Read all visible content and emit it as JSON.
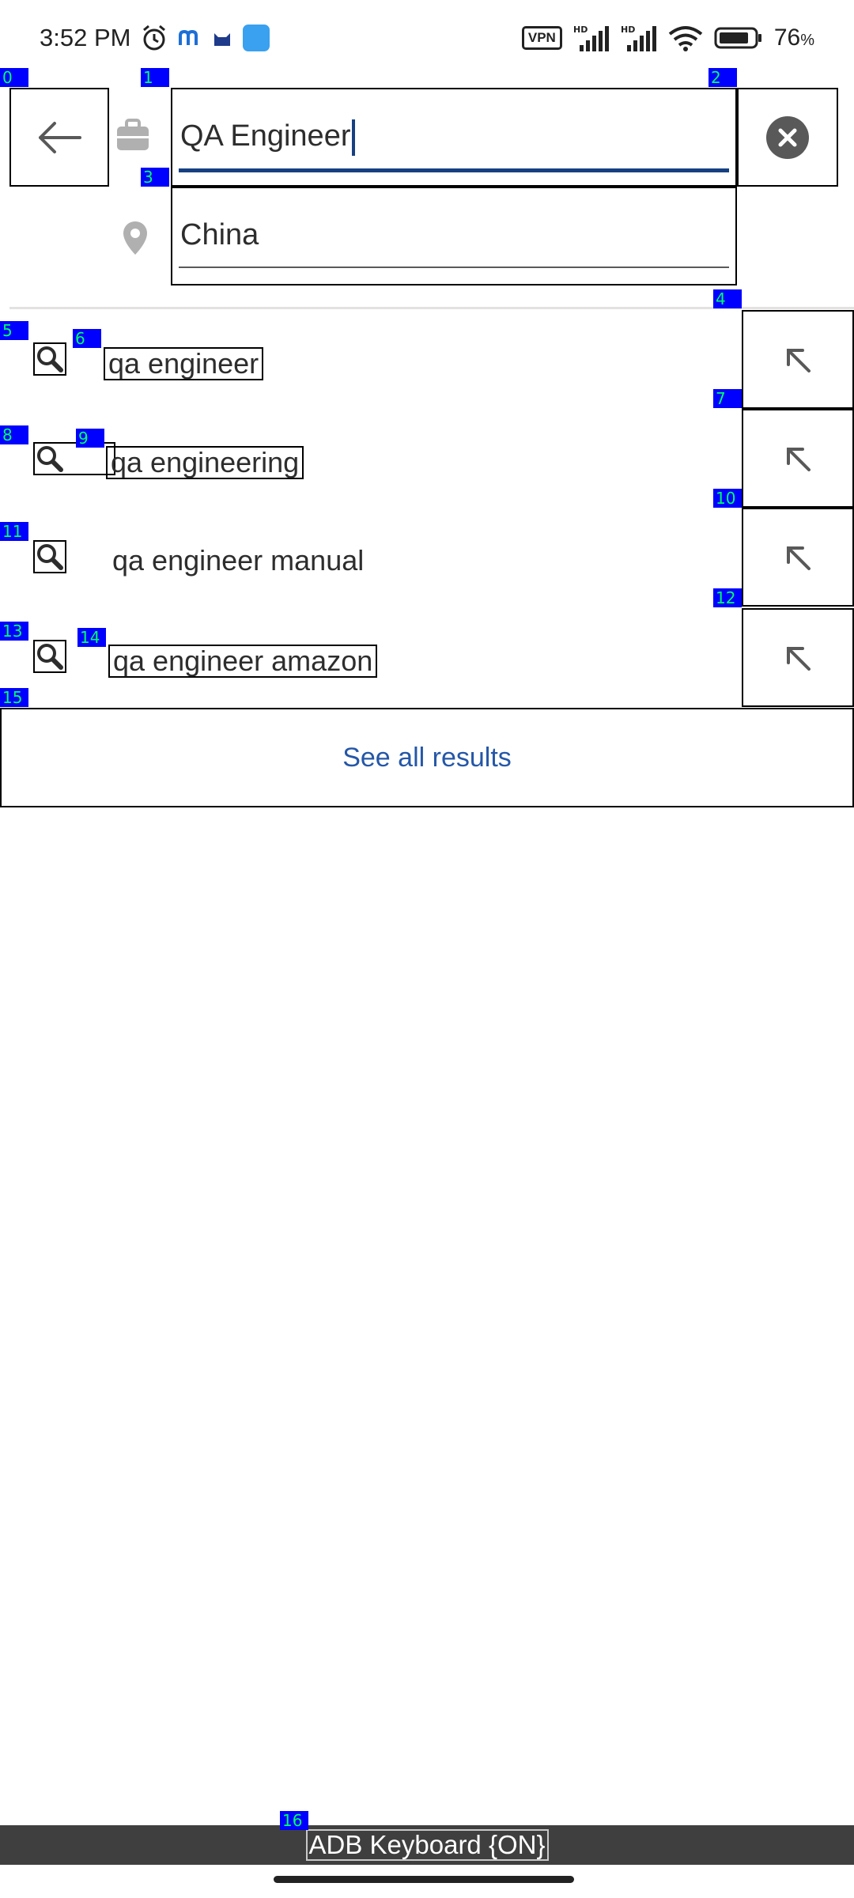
{
  "status_bar": {
    "time": "3:52 PM",
    "vpn": "VPN",
    "battery": "76"
  },
  "search": {
    "job_value": "QA Engineer",
    "location_value": "China"
  },
  "suggestions": [
    {
      "label": "qa engineer"
    },
    {
      "label": "qa engineering"
    },
    {
      "label": "qa engineer manual"
    },
    {
      "label": "qa engineer amazon"
    }
  ],
  "see_all": "See all results",
  "adb_keyboard": "ADB Keyboard {ON}",
  "tags": [
    "0",
    "1",
    "2",
    "3",
    "4",
    "5",
    "6",
    "7",
    "8",
    "9",
    "10",
    "11",
    "12",
    "13",
    "14",
    "15",
    "16"
  ],
  "colors": {
    "accent_blue": "#2557a7",
    "field_focus": "#164081",
    "icon_grey": "#b0b0b0",
    "tag_bg": "#0000ff",
    "tag_text": "#00ff66"
  }
}
